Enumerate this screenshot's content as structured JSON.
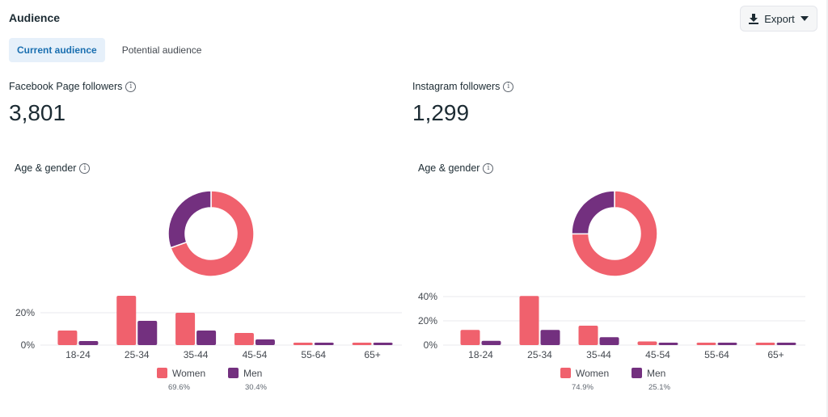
{
  "header": {
    "title": "Audience",
    "export_label": "Export",
    "export_icon": "download-icon",
    "export_caret_icon": "caret-down-icon"
  },
  "tabs": [
    {
      "label": "Current audience",
      "active": true
    },
    {
      "label": "Potential audience",
      "active": false
    }
  ],
  "colors": {
    "women": "#f0616d",
    "men": "#73307f",
    "accent": "#1a6fb0",
    "grid": "#e9eaec"
  },
  "panels": [
    {
      "metric_label": "Facebook Page followers",
      "metric_value": "3,801",
      "section_label": "Age & gender",
      "legend": [
        {
          "name": "Women",
          "pct": "69.6%"
        },
        {
          "name": "Men",
          "pct": "30.4%"
        }
      ]
    },
    {
      "metric_label": "Instagram followers",
      "metric_value": "1,299",
      "section_label": "Age & gender",
      "legend": [
        {
          "name": "Women",
          "pct": "74.9%"
        },
        {
          "name": "Men",
          "pct": "25.1%"
        }
      ]
    }
  ],
  "chart_data": [
    {
      "type": "pie",
      "title": "Facebook Page followers — Age & gender",
      "donut": true,
      "categories": [
        "Women",
        "Men"
      ],
      "values": [
        69.6,
        30.4
      ]
    },
    {
      "type": "bar",
      "title": "Facebook Page followers — Age & gender",
      "categories": [
        "18-24",
        "25-34",
        "35-44",
        "45-54",
        "55-64",
        "65+"
      ],
      "series": [
        {
          "name": "Women",
          "values": [
            9,
            30.5,
            20,
            7.5,
            1.5,
            1.5
          ]
        },
        {
          "name": "Men",
          "values": [
            2.5,
            15,
            9,
            3.5,
            1.5,
            1.5
          ]
        }
      ],
      "yticks": [
        "0%",
        "20%"
      ],
      "ytick_values": [
        0,
        20
      ],
      "ylim": [
        0,
        20
      ],
      "grid": true,
      "legend": "bottom"
    },
    {
      "type": "pie",
      "title": "Instagram followers — Age & gender",
      "donut": true,
      "categories": [
        "Women",
        "Men"
      ],
      "values": [
        74.9,
        25.1
      ]
    },
    {
      "type": "bar",
      "title": "Instagram followers — Age & gender",
      "categories": [
        "18-24",
        "25-34",
        "35-44",
        "45-54",
        "55-64",
        "65+"
      ],
      "series": [
        {
          "name": "Women",
          "values": [
            12.5,
            40.5,
            16,
            3,
            2,
            2
          ]
        },
        {
          "name": "Men",
          "values": [
            3.5,
            12.5,
            6.5,
            2,
            2,
            2
          ]
        }
      ],
      "yticks": [
        "0%",
        "20%",
        "40%"
      ],
      "ytick_values": [
        0,
        20,
        40
      ],
      "ylim": [
        0,
        40
      ],
      "grid": true,
      "legend": "bottom"
    }
  ]
}
